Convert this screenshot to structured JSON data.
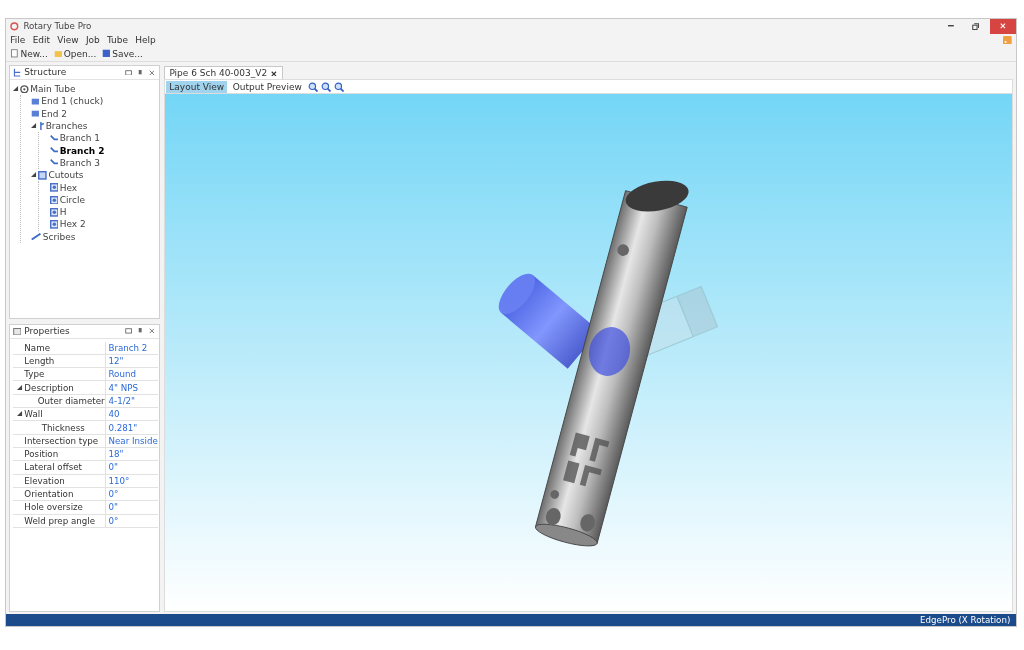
{
  "window": {
    "title": "Rotary Tube Pro"
  },
  "menu": [
    "File",
    "Edit",
    "View",
    "Job",
    "Tube",
    "Help"
  ],
  "toolbar": [
    "New...",
    "Open...",
    "Save..."
  ],
  "structure": {
    "title": "Structure",
    "tree": [
      {
        "label": "Main Tube",
        "kind": "tube",
        "selected": false,
        "expanded": true,
        "children": [
          {
            "label": "End 1 (chuck)",
            "kind": "end",
            "selected": false
          },
          {
            "label": "End 2",
            "kind": "end",
            "selected": false
          },
          {
            "label": "Branches",
            "kind": "group",
            "selected": false,
            "expanded": true,
            "children": [
              {
                "label": "Branch 1",
                "kind": "branch",
                "selected": false
              },
              {
                "label": "Branch 2",
                "kind": "branch",
                "selected": true
              },
              {
                "label": "Branch 3",
                "kind": "branch",
                "selected": false
              }
            ]
          },
          {
            "label": "Cutouts",
            "kind": "cutouts",
            "selected": false,
            "expanded": true,
            "children": [
              {
                "label": "Hex",
                "kind": "cutout",
                "selected": false
              },
              {
                "label": "Circle",
                "kind": "cutout",
                "selected": false
              },
              {
                "label": "H",
                "kind": "cutout",
                "selected": false
              },
              {
                "label": "Hex 2",
                "kind": "cutout",
                "selected": false
              }
            ]
          },
          {
            "label": "Scribes",
            "kind": "scribe",
            "selected": false
          }
        ]
      }
    ]
  },
  "properties": {
    "title": "Properties",
    "rows": [
      {
        "name": "Name",
        "value": "Branch 2"
      },
      {
        "name": "Length",
        "value": "12\""
      },
      {
        "name": "Type",
        "value": "Round"
      },
      {
        "name": "Description",
        "value": "4\" NPS",
        "expanded": true,
        "children": [
          {
            "name": "Outer diameter",
            "value": "4-1/2\""
          }
        ]
      },
      {
        "name": "Wall",
        "value": "40",
        "expanded": true,
        "children": [
          {
            "name": "Thickness",
            "value": "0.281\""
          }
        ]
      },
      {
        "name": "Intersection type",
        "value": "Near Inside"
      },
      {
        "name": "Position",
        "value": "18\""
      },
      {
        "name": "Lateral offset",
        "value": "0\""
      },
      {
        "name": "Elevation",
        "value": "110°"
      },
      {
        "name": "Orientation",
        "value": "0°"
      },
      {
        "name": "Hole oversize",
        "value": "0\""
      },
      {
        "name": "Weld prep angle",
        "value": "0°"
      }
    ]
  },
  "document": {
    "tab": "Pipe 6 Sch 40-003_V2",
    "views": [
      {
        "label": "Layout View",
        "selected": true
      },
      {
        "label": "Output Preview",
        "selected": false
      }
    ]
  },
  "status": "EdgePro (X Rotation)"
}
